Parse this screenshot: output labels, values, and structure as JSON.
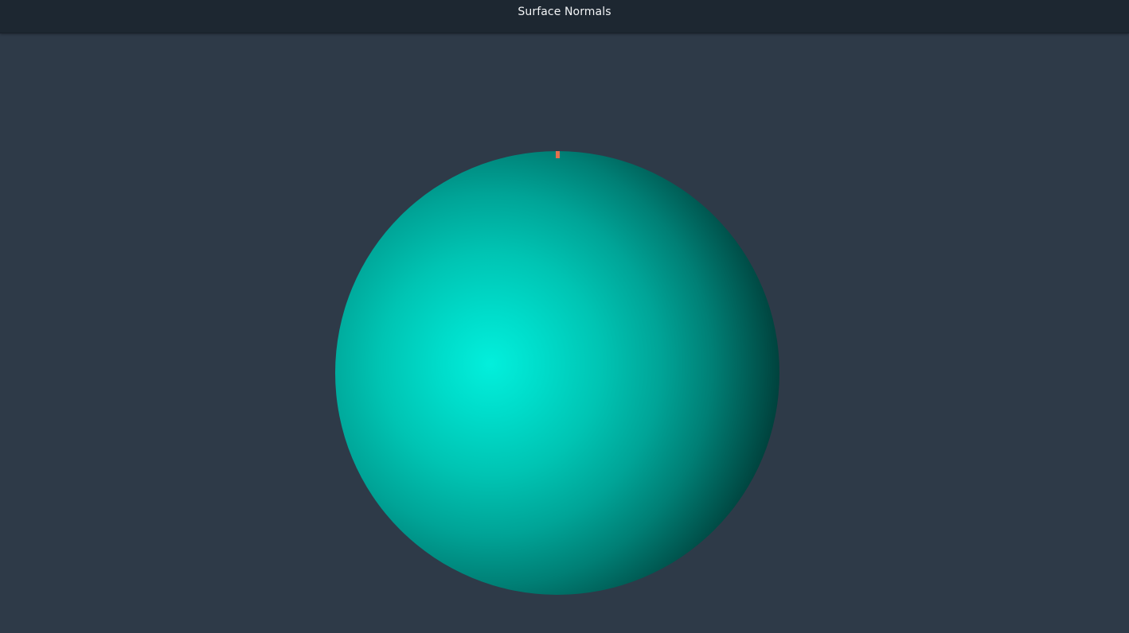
{
  "window": {
    "title": "Surface Normals"
  },
  "scene": {
    "object": "sphere",
    "sphere_color": "#00e5d2",
    "background_color": "#2e3a48",
    "marker_color": "#e4704d"
  }
}
